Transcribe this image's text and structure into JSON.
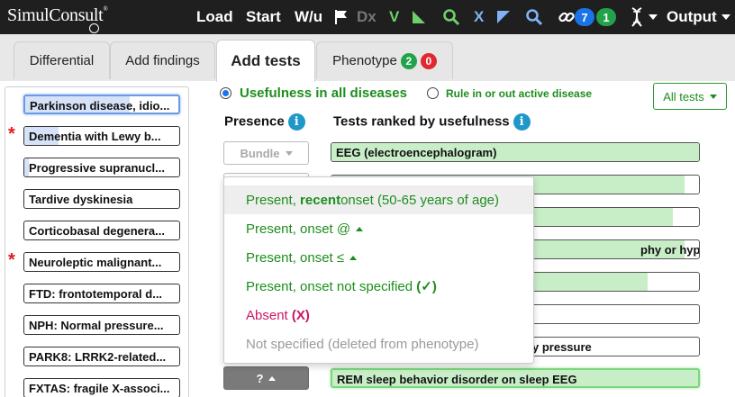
{
  "app": {
    "logo_text": "SimulConsult",
    "logo_mark": "®"
  },
  "topbar": {
    "load": "Load",
    "start": "Start",
    "wu": "W/u",
    "dx": "Dx",
    "v": "V",
    "x": "X",
    "badge_blue": "7",
    "badge_green": "1",
    "output": "Output"
  },
  "tabs": [
    {
      "label": "Differential"
    },
    {
      "label": "Add findings"
    },
    {
      "label": "Add tests"
    },
    {
      "label": "Phenotype",
      "badge_green": "2",
      "badge_red": "0"
    }
  ],
  "diagnoses": [
    {
      "label": "Parkinson disease, idio...",
      "starred": false,
      "selected": true,
      "fill": 0.68
    },
    {
      "label": "Dementia with Lewy b...",
      "starred": true,
      "selected": false,
      "fill": 0.22
    },
    {
      "label": "Progressive supranucl...",
      "starred": false,
      "selected": false,
      "fill": 0.03
    },
    {
      "label": "Tardive dyskinesia",
      "starred": false,
      "selected": false,
      "fill": 0
    },
    {
      "label": "Corticobasal degenera...",
      "starred": false,
      "selected": false,
      "fill": 0
    },
    {
      "label": "Neuroleptic malignant...",
      "starred": true,
      "selected": false,
      "fill": 0
    },
    {
      "label": "FTD: frontotemporal d...",
      "starred": false,
      "selected": false,
      "fill": 0
    },
    {
      "label": "NPH: Normal pressure...",
      "starred": false,
      "selected": false,
      "fill": 0
    },
    {
      "label": "PARK8: LRRK2-related...",
      "starred": false,
      "selected": false,
      "fill": 0
    },
    {
      "label": "FXTAS: fragile X-associ...",
      "starred": false,
      "selected": false,
      "fill": 0
    }
  ],
  "options": {
    "usefulness_all": "Usefulness in all diseases",
    "rule_in_out": "Rule in or out active disease",
    "all_tests": "All tests"
  },
  "columns": {
    "presence": "Presence",
    "ranked": "Tests ranked by usefulness",
    "info_glyph": "i"
  },
  "buttons": {
    "bundle": "Bundle",
    "unknown": "?"
  },
  "tests": [
    {
      "label": "EEG (electroencephalogram)",
      "fill": 1.0
    },
    {
      "label": "",
      "fill": 0.96
    },
    {
      "label": "",
      "fill": 0.93
    },
    {
      "label": "phy or hypoplasia",
      "fill": 0.96
    },
    {
      "label": "",
      "fill": 0.86
    },
    {
      "label": "",
      "fill": 0.0
    },
    {
      "label": "y pressure",
      "fill": 0.0
    },
    {
      "label": "REM sleep behavior disorder on sleep EEG",
      "fill": 1.0
    }
  ],
  "dropdown": {
    "recent_pre": "Present, ",
    "recent_bold": "recent",
    "recent_post": " onset (50-65 years of age)",
    "onset_at": "Present, onset @",
    "onset_le": "Present, onset ≤",
    "not_specified_pre": "Present, onset not specified ",
    "not_specified_mark": "(✓)",
    "absent_pre": "Absent ",
    "absent_mark": "(X)",
    "deleted": "Not specified (deleted from phenotype)"
  },
  "colors": {
    "green": "#1d8e1d",
    "magenta": "#cc1666",
    "grey_text": "#9a9a9a",
    "blue_badge": "#1a73e8",
    "green_badge": "#22a24a",
    "red_badge": "#e0282e",
    "info_blue": "#1e98c9",
    "bar_fill": "#c8eec8",
    "dx_fill": "#d6e2f7"
  }
}
